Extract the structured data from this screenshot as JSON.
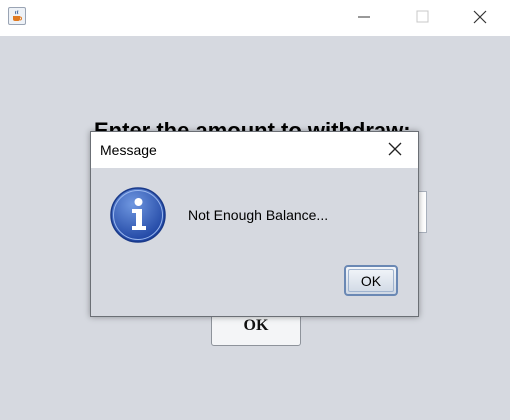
{
  "window": {
    "app_icon": "java-cup-icon",
    "controls": {
      "minimize": "minimize-icon",
      "maximize": "maximize-icon",
      "close": "close-icon"
    }
  },
  "main": {
    "prompt": "Enter the amount to withdraw:",
    "ok_label": "OK"
  },
  "dialog": {
    "title": "Message",
    "message": "Not Enough Balance...",
    "ok_label": "OK",
    "icon": "info-icon"
  },
  "colors": {
    "content_bg": "#d6d9e0",
    "info_icon_blue": "#2f58b8",
    "ok_border": "#6a88b4"
  }
}
